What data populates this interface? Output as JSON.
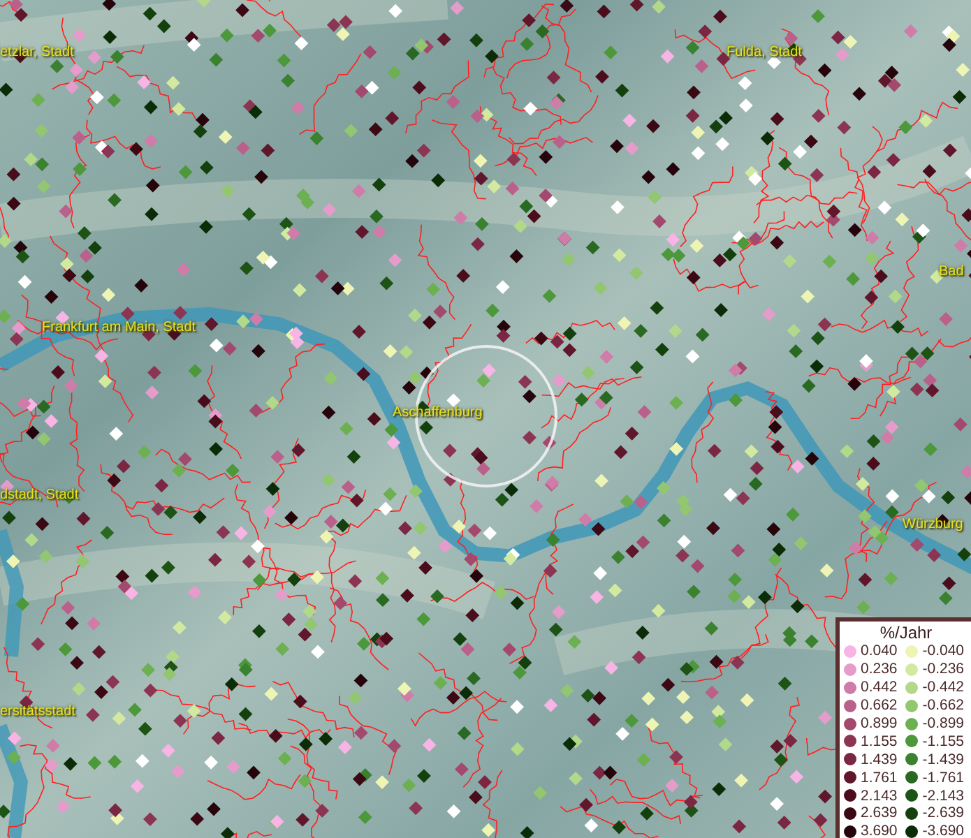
{
  "map": {
    "places": [
      {
        "name": "etzlar, Stadt"
      },
      {
        "name": "Fulda, Stadt"
      },
      {
        "name": "Bad"
      },
      {
        "name": "Frankfurt am Main, Stadt"
      },
      {
        "name": "Aschaffenburg"
      },
      {
        "name": "dstadt, Stadt"
      },
      {
        "name": "Würzburg"
      },
      {
        "name": "ersitätsstadt"
      }
    ]
  },
  "legend": {
    "title": "%/Jahr",
    "items": [
      {
        "value": "0.040",
        "color": "#f7b4e4"
      },
      {
        "value": "-0.040",
        "color": "#eef5b4"
      },
      {
        "value": "0.236",
        "color": "#e59ccb"
      },
      {
        "value": "-0.236",
        "color": "#d2eaa0"
      },
      {
        "value": "0.442",
        "color": "#d07ca9"
      },
      {
        "value": "-0.442",
        "color": "#b2d98a"
      },
      {
        "value": "0.662",
        "color": "#b9618b"
      },
      {
        "value": "-0.662",
        "color": "#92c670"
      },
      {
        "value": "0.899",
        "color": "#a2496d"
      },
      {
        "value": "-0.899",
        "color": "#6cb052"
      },
      {
        "value": "1.155",
        "color": "#8c3553"
      },
      {
        "value": "-1.155",
        "color": "#4c983b"
      },
      {
        "value": "1.439",
        "color": "#7b2642"
      },
      {
        "value": "-1.439",
        "color": "#3a8130"
      },
      {
        "value": "1.761",
        "color": "#61172b"
      },
      {
        "value": "-1.761",
        "color": "#296921"
      },
      {
        "value": "2.143",
        "color": "#4b0d1b"
      },
      {
        "value": "-2.143",
        "color": "#1d5315"
      },
      {
        "value": "2.639",
        "color": "#3b0813"
      },
      {
        "value": "-2.639",
        "color": "#13400d"
      },
      {
        "value": "3.690",
        "color": "#26040b"
      },
      {
        "value": "-3.690",
        "color": "#0b2c07"
      }
    ]
  }
}
